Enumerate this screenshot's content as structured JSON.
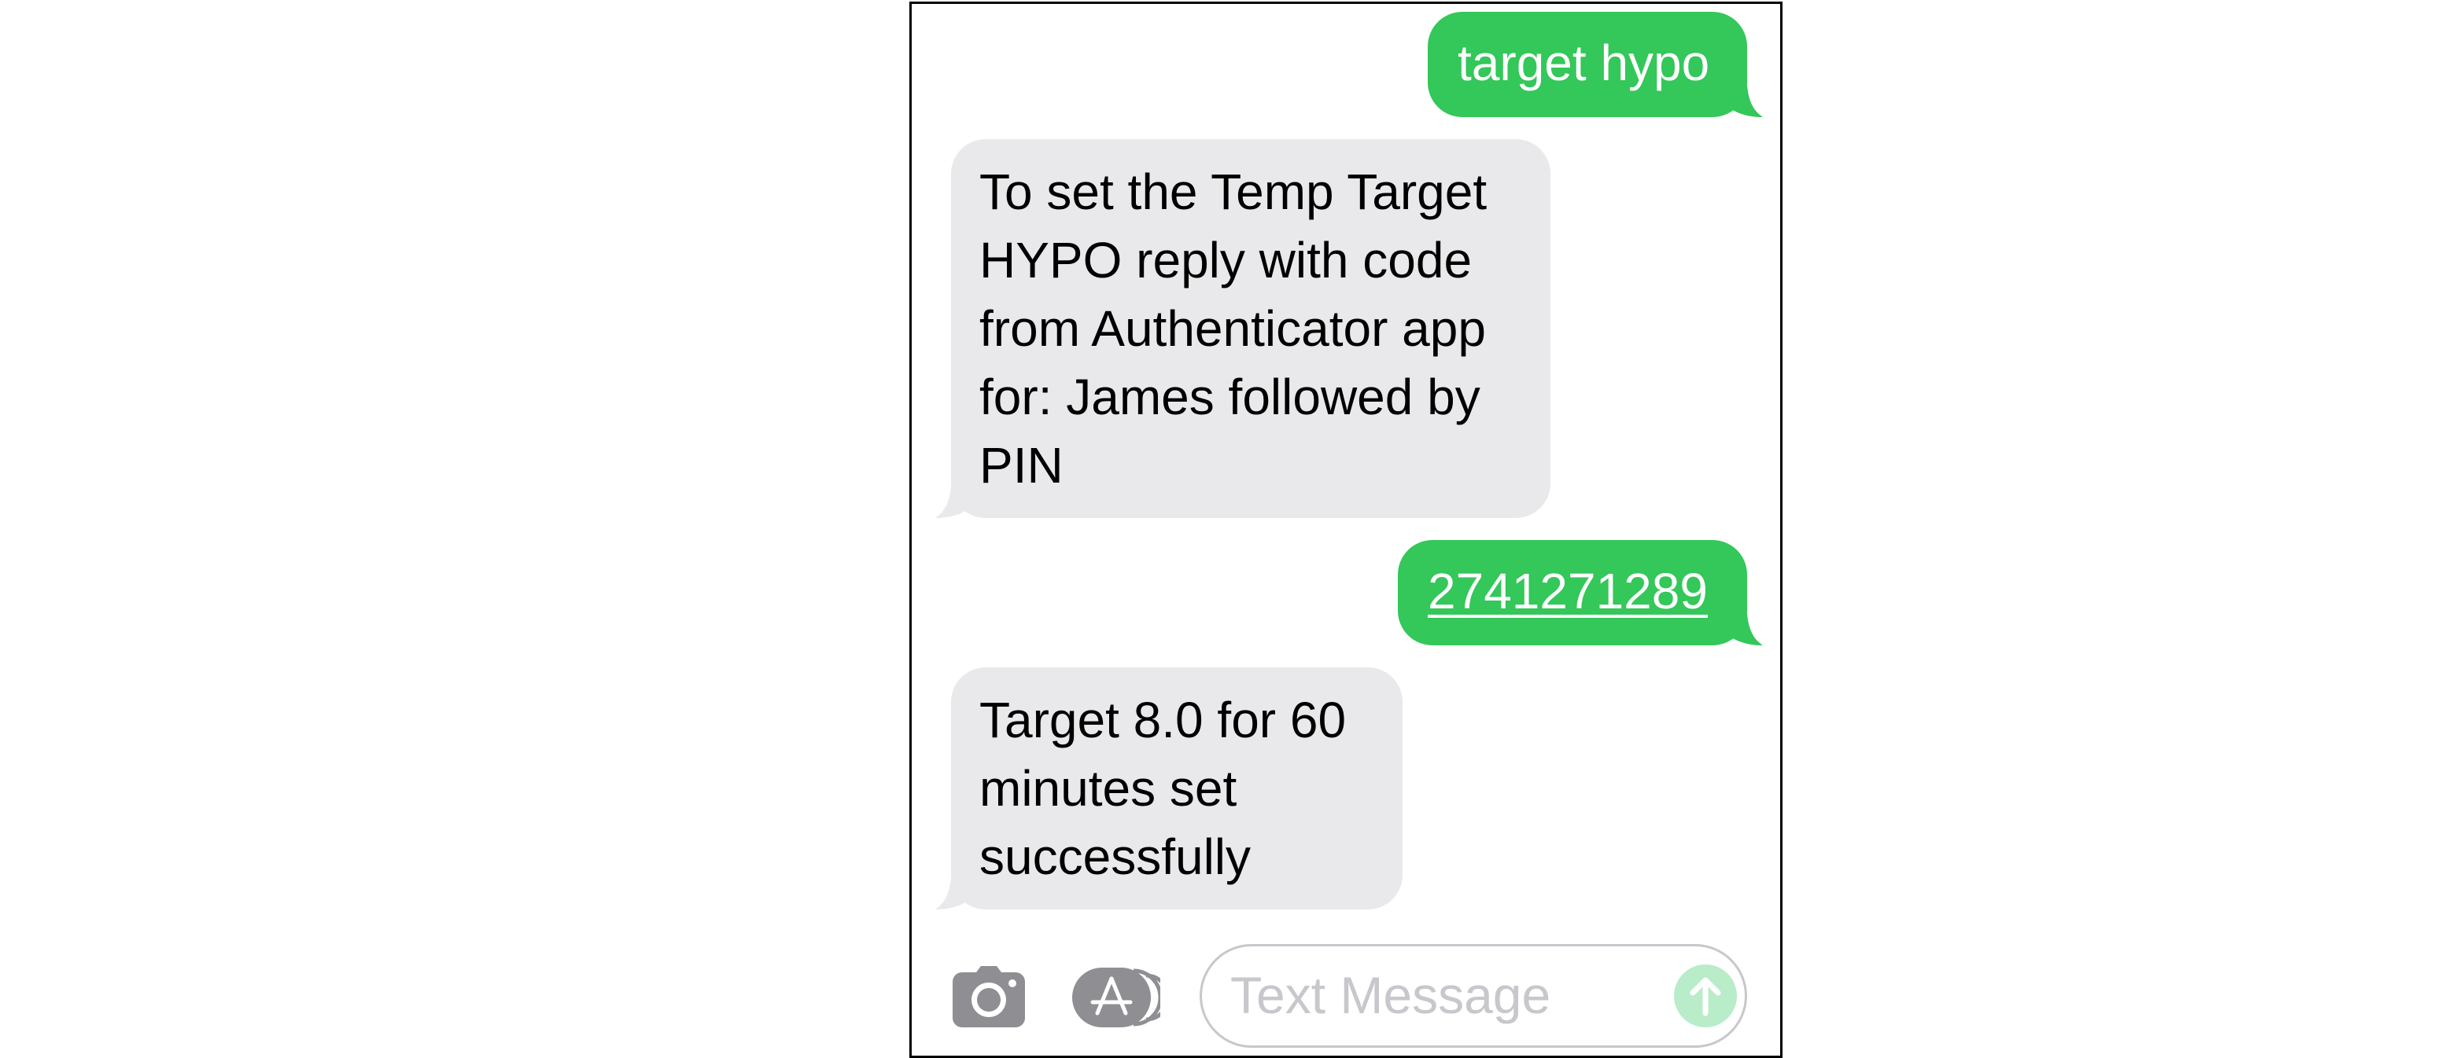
{
  "messages": [
    {
      "direction": "sent",
      "text": "target hypo"
    },
    {
      "direction": "received",
      "lines": [
        "To set the Temp Target",
        "HYPO reply with code",
        "from Authenticator app",
        "for: James followed by",
        "PIN"
      ]
    },
    {
      "direction": "sent",
      "text": "2741271289",
      "is_link": true
    },
    {
      "direction": "received",
      "lines": [
        "Target 8.0 for 60",
        "minutes set",
        "successfully"
      ]
    }
  ],
  "composer": {
    "camera_icon": "camera-icon",
    "appstore_icon": "app-store-icon",
    "placeholder": "Text Message",
    "send_icon": "arrow-up-icon"
  },
  "colors": {
    "sent_bubble": "#34c759",
    "received_bubble": "#e9e9eb",
    "icon_gray": "#8e8e93",
    "send_disabled": "#b9ecc9"
  }
}
